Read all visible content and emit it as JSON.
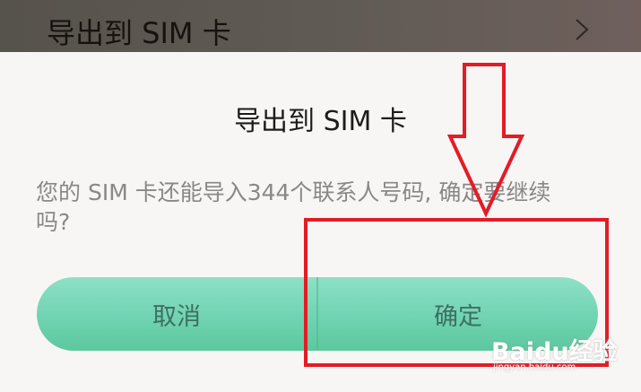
{
  "background_row": {
    "label": "导出到 SIM 卡"
  },
  "dialog": {
    "title": "导出到 SIM 卡",
    "message": "您的 SIM 卡还能导入344个联系人号码, 确定要继续吗?",
    "buttons": {
      "cancel_label": "取消",
      "confirm_label": "确定"
    }
  },
  "colors": {
    "button_accent": "#70d3b2",
    "annotation_red": "#e31c25"
  },
  "watermark": {
    "brand": "Baidu经验",
    "url": "jingyan.baidu.com"
  }
}
